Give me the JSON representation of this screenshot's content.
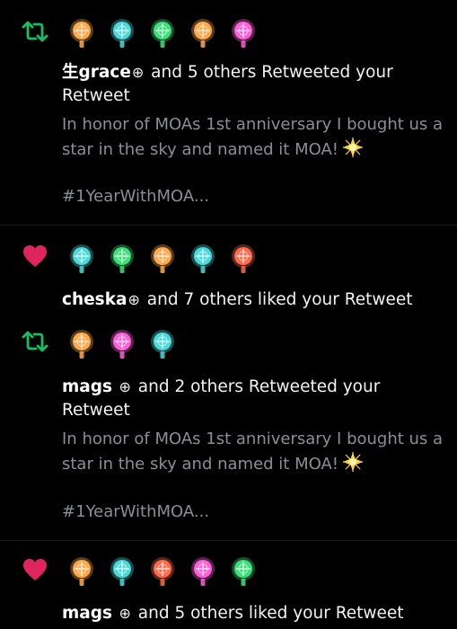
{
  "colors": {
    "retweet": "#17bf63",
    "like": "#e0245e",
    "text": "#f2f2f2",
    "secondary": "#8a8f96"
  },
  "notifications": [
    {
      "type": "retweet",
      "icon": "retweet-icon",
      "avatar_colors": [
        "#ffa94d",
        "#4dd9d9",
        "#3ee07a",
        "#ffa94d",
        "#ff5fd7"
      ],
      "name": "生grace",
      "mark": "⊕",
      "action": " and 5 others Retweeted your Retweet",
      "tweet_text": "In honor of MOAs 1st anniversary I bought us a star in the sky and named it MOA!",
      "hashtag": "#1YearWithMOA..."
    },
    {
      "type": "like",
      "icon": "heart-icon",
      "avatar_colors": [
        "#4dd9d9",
        "#3ee07a",
        "#ffa94d",
        "#4dd9d9",
        "#ff6a4d"
      ],
      "name": "cheska",
      "mark": "⊕",
      "action": " and 7 others liked your Retweet"
    },
    {
      "type": "retweet",
      "icon": "retweet-icon",
      "avatar_colors": [
        "#ffa94d",
        "#ff5fd7",
        "#4dd9d9"
      ],
      "name": "mags ",
      "mark": "⊕",
      "action": " and 2 others Retweeted your Retweet",
      "tweet_text": "In honor of MOAs 1st anniversary I bought us a star in the sky and named it MOA!",
      "hashtag": "#1YearWithMOA..."
    },
    {
      "type": "like",
      "icon": "heart-icon",
      "avatar_colors": [
        "#ffa94d",
        "#4dd9d9",
        "#ff6a4d",
        "#ff5fd7",
        "#3ee07a"
      ],
      "name": "mags ",
      "mark": "⊕",
      "action": " and 5 others liked your Retweet"
    }
  ]
}
